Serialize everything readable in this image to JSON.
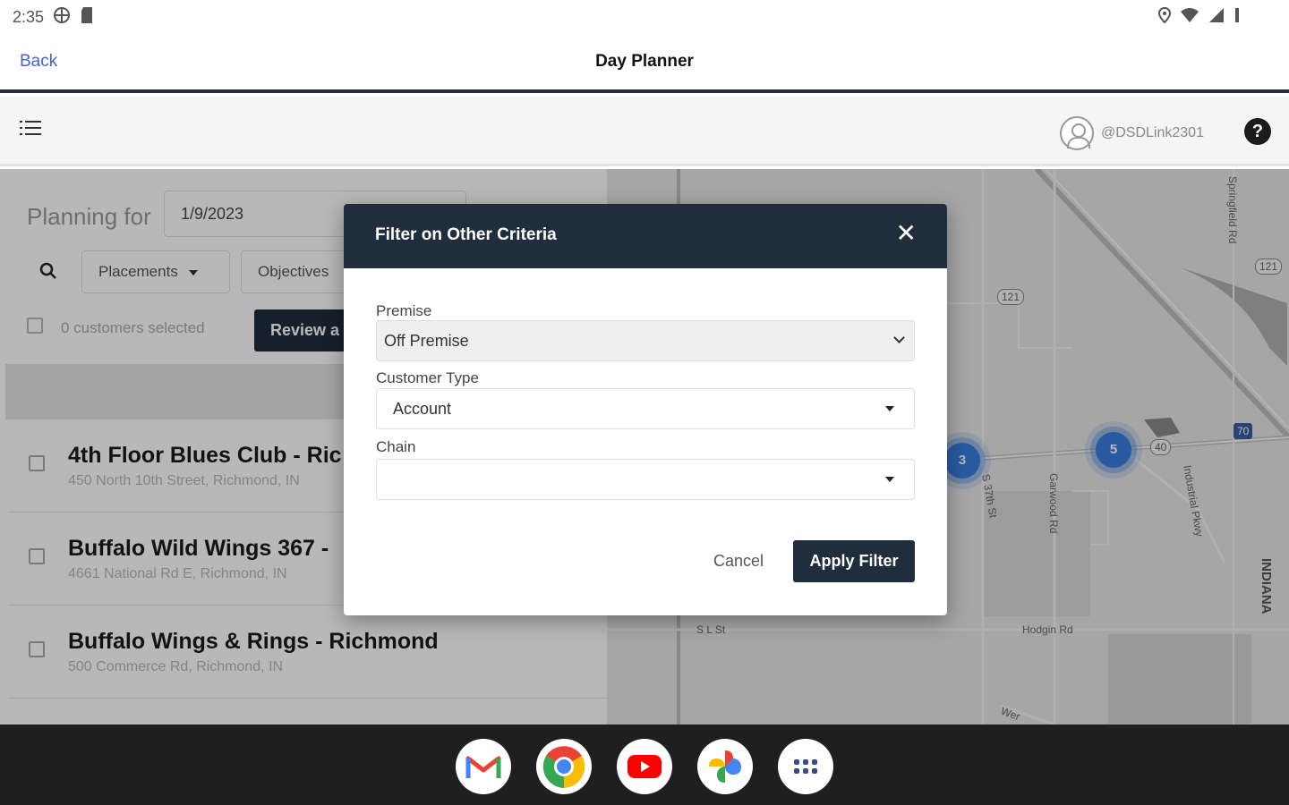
{
  "status_bar": {
    "time": "2:35",
    "left_icons": [
      "vpn-icon",
      "sd-card-icon"
    ],
    "right_icons": [
      "location-icon",
      "wifi-icon",
      "signal-icon",
      "battery-icon"
    ]
  },
  "app_bar": {
    "back_label": "Back",
    "title": "Day Planner"
  },
  "toolbar": {
    "username": "@DSDLink2301",
    "help_label": "?"
  },
  "planner": {
    "planning_label": "Planning for",
    "date_value": "1/9/2023",
    "filters": [
      {
        "label": "Placements"
      },
      {
        "label": "Objectives"
      }
    ],
    "selected_count": "0 customers selected",
    "review_label": "Review a"
  },
  "customers": [
    {
      "name": "4th Floor Blues Club - Ric",
      "address": "450 North 10th Street, Richmond, IN"
    },
    {
      "name": "Buffalo Wild Wings 367 -",
      "address": "4661 National Rd E, Richmond, IN"
    },
    {
      "name": "Buffalo Wings & Rings - Richmond",
      "address": "500 Commerce Rd, Richmond, IN"
    }
  ],
  "map": {
    "clusters": [
      "3",
      "5"
    ],
    "labels": {
      "s37th": "S 37th St",
      "garwood": "Garwood Rd",
      "industrial": "Industrial Pkwy",
      "hodgin": "Hodgin Rd",
      "sl": "S L St",
      "indiana": "INDIANA",
      "route121": "121",
      "route121b": "121",
      "route40": "40",
      "i70": "70",
      "springfield": "Springfield Rd",
      "wer": "Wer"
    }
  },
  "modal": {
    "title": "Filter on Other Criteria",
    "close_label": "✕",
    "premise_label": "Premise",
    "premise_value": "Off Premise",
    "customer_type_label": "Customer Type",
    "customer_type_value": "Account",
    "chain_label": "Chain",
    "chain_value": "",
    "cancel_label": "Cancel",
    "apply_label": "Apply Filter"
  },
  "dock": {
    "apps": [
      "gmail-icon",
      "chrome-icon",
      "youtube-icon",
      "photos-icon",
      "app-drawer-icon"
    ]
  },
  "colors": {
    "navy": "#1f2d3d",
    "link": "#4a63c8",
    "cluster": "#3a7de0"
  }
}
